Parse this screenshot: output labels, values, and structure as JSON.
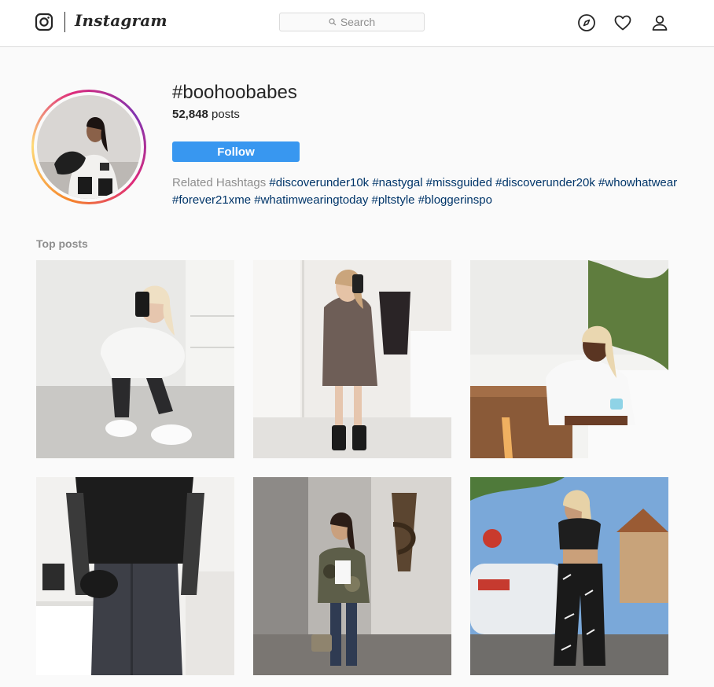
{
  "nav": {
    "logo_icon": "instagram-camera-icon",
    "wordmark": "Instagram",
    "search_placeholder": "Search",
    "icons": [
      "explore-compass-icon",
      "activity-heart-icon",
      "profile-person-icon"
    ]
  },
  "header": {
    "hashtag": "#boohoobabes",
    "post_count": "52,848",
    "post_count_suffix": " posts",
    "follow_label": "Follow",
    "follow_color": "#3897f0",
    "related_label": "Related Hashtags",
    "related_tags": [
      "#discoverunder10k",
      "#nastygal",
      "#missguided",
      "#discoverunder20k",
      "#whowhatwear",
      "#forever21xme",
      "#whatimwearingtoday",
      "#pltstyle",
      "#bloggerinspo"
    ]
  },
  "top_posts": {
    "label": "Top posts"
  },
  "colors": {
    "link": "#003569",
    "muted": "#8e8e8e",
    "text": "#262626"
  }
}
